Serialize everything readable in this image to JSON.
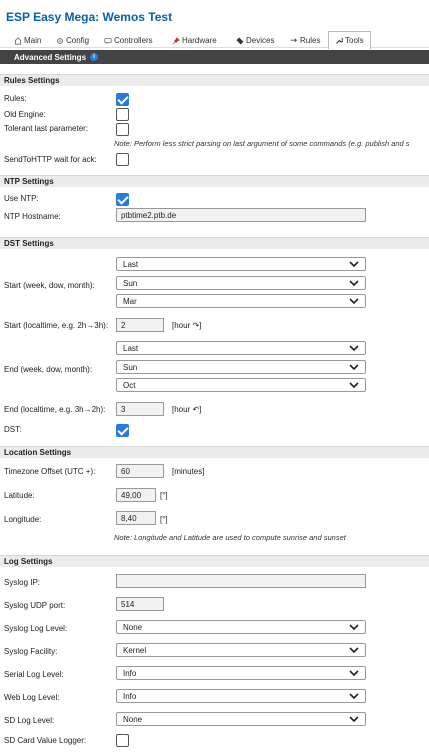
{
  "app_title": "ESP Easy Mega: Wemos Test",
  "tabs": [
    {
      "label": "Main"
    },
    {
      "label": "Config"
    },
    {
      "label": "Controllers"
    },
    {
      "label": "Hardware"
    },
    {
      "label": "Devices"
    },
    {
      "label": "Rules"
    },
    {
      "label": "Tools"
    }
  ],
  "advanced_settings_label": "Advanced Settings",
  "rules": {
    "header": "Rules Settings",
    "rules_label": "Rules:",
    "rules_checked": true,
    "old_engine_label": "Old Engine:",
    "old_engine_checked": false,
    "tolerant_label": "Tolerant last parameter:",
    "tolerant_checked": false,
    "tolerant_note": "Note: Perform less strict parsing on last argument of some commands (e.g. publish and s",
    "sendtohttp_label": "SendToHTTP wait for ack:",
    "sendtohttp_checked": false
  },
  "ntp": {
    "header": "NTP Settings",
    "use_ntp_label": "Use NTP:",
    "use_ntp_checked": true,
    "hostname_label": "NTP Hostname:",
    "hostname_value": "ptbtime2.ptb.de"
  },
  "dst": {
    "header": "DST Settings",
    "start_week": "Last",
    "start_dow": "Sun",
    "start_month": "Mar",
    "start_label": "Start (week, dow, month):",
    "start_time_label": "Start (localtime, e.g. 2h→3h):",
    "start_time_value": "2",
    "start_time_unit": "[hour ↷]",
    "end_week": "Last",
    "end_dow": "Sun",
    "end_month": "Oct",
    "end_label": "End (week, dow, month):",
    "end_time_label": "End (localtime, e.g. 3h→2h):",
    "end_time_value": "3",
    "end_time_unit": "[hour ↶]",
    "dst_label": "DST:",
    "dst_checked": true
  },
  "location": {
    "header": "Location Settings",
    "timezone_label": "Timezone Offset (UTC +):",
    "timezone_value": "60",
    "timezone_unit": "[minutes]",
    "latitude_label": "Latitude:",
    "latitude_value": "49,00",
    "latitude_unit": "[°]",
    "longitude_label": "Longitude:",
    "longitude_value": "8,40",
    "longitude_unit": "[°]",
    "note": "Note: Longitude and Latitude are used to compute sunrise and sunset"
  },
  "log": {
    "header": "Log Settings",
    "syslog_ip_label": "Syslog IP:",
    "syslog_ip_value": "",
    "syslog_port_label": "Syslog UDP port:",
    "syslog_port_value": "514",
    "syslog_level_label": "Syslog Log Level:",
    "syslog_level_value": "None",
    "syslog_facility_label": "Syslog Facility:",
    "syslog_facility_value": "Kernel",
    "serial_level_label": "Serial Log Level:",
    "serial_level_value": "Info",
    "web_level_label": "Web Log Level:",
    "web_level_value": "Info",
    "sd_level_label": "SD Log Level:",
    "sd_level_value": "None",
    "sd_card_label": "SD Card Value Logger:",
    "sd_card_checked": false
  },
  "colors": {
    "title": "#0b5fa5",
    "checkbox_on": "#2a7ae2",
    "dark_bar": "#444444"
  }
}
